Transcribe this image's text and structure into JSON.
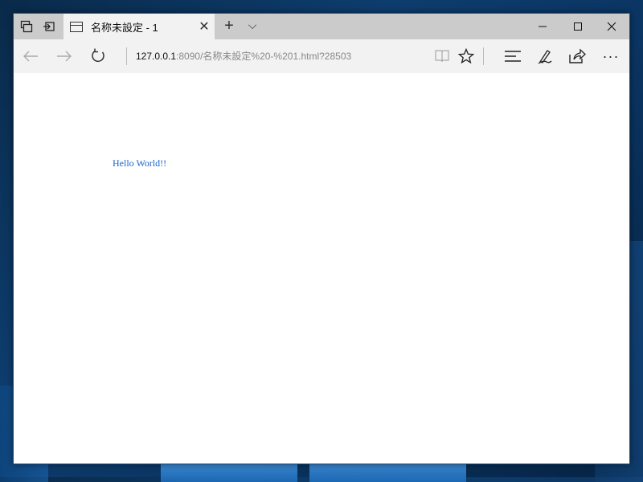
{
  "titlebar": {
    "tab_title": "名称未設定 - 1",
    "new_tab_symbol": "+",
    "tab_menu_symbol": "⌵",
    "close_tab_symbol": "✕",
    "minimize_symbol": "—",
    "maximize_symbol": "☐",
    "close_window_symbol": "✕"
  },
  "navbar": {
    "back_symbol": "←",
    "forward_symbol": "→",
    "refresh_symbol": "↻",
    "address_host": "127.0.0.1",
    "address_path": ":8090/名称未設定%20-%201.html?28503",
    "reading_view_symbol": "📖",
    "favorite_symbol": "☆",
    "hub_symbol": "≡",
    "note_symbol": "✎",
    "share_symbol": "⇪",
    "more_symbol": "···"
  },
  "content": {
    "text": "Hello World!!"
  },
  "icons": {
    "tab_preview": "tab-preview-icon",
    "set_aside": "set-aside-tabs-icon",
    "page": "page-icon"
  },
  "colors": {
    "titlebar": "#cbcbcb",
    "toolbar": "#f2f2f2",
    "link_text": "#1a64c8"
  }
}
